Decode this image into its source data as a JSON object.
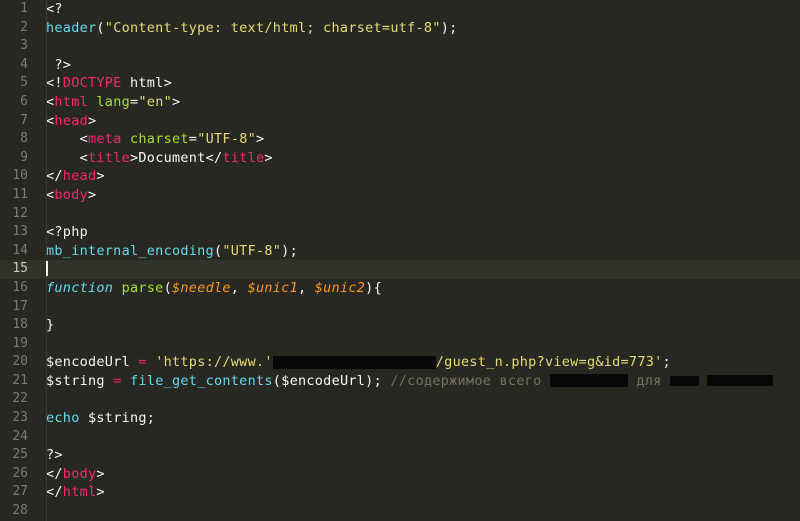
{
  "editor": {
    "theme_name": "monokai-dark",
    "background": "#272822",
    "gutter_color": "#7a7d72",
    "active_line_number": 15,
    "total_visible_lines": 28,
    "colors": {
      "tag": "#f92672",
      "attribute": "#a6e22e",
      "string": "#e6db74",
      "function": "#66d9ef",
      "keyword": "#66d9ef",
      "parameter": "#fd971f",
      "operator": "#f92672",
      "comment": "#75715e",
      "text": "#f8f8f2",
      "redaction": "#070707"
    },
    "language": "php"
  },
  "lines": [
    {
      "n": "1",
      "tokens": [
        {
          "t": "punc",
          "v": "<?"
        }
      ]
    },
    {
      "n": "2",
      "tokens": [
        {
          "t": "func",
          "v": "header"
        },
        {
          "t": "punc",
          "v": "("
        },
        {
          "t": "str",
          "v": "\"Content-type: text/html; charset=utf-8\""
        },
        {
          "t": "punc",
          "v": ");"
        }
      ]
    },
    {
      "n": "3",
      "tokens": []
    },
    {
      "n": "4",
      "tokens": [
        {
          "t": "punc",
          "v": " ?>"
        }
      ]
    },
    {
      "n": "5",
      "tokens": [
        {
          "t": "punc",
          "v": "<!"
        },
        {
          "t": "tag",
          "v": "DOCTYPE"
        },
        {
          "t": "plain",
          "v": " html>"
        }
      ]
    },
    {
      "n": "6",
      "tokens": [
        {
          "t": "punc",
          "v": "<"
        },
        {
          "t": "tag",
          "v": "html"
        },
        {
          "t": "plain",
          "v": " "
        },
        {
          "t": "attr",
          "v": "lang"
        },
        {
          "t": "plain",
          "v": "="
        },
        {
          "t": "str",
          "v": "\"en\""
        },
        {
          "t": "punc",
          "v": ">"
        }
      ]
    },
    {
      "n": "7",
      "tokens": [
        {
          "t": "punc",
          "v": "<"
        },
        {
          "t": "tag",
          "v": "head"
        },
        {
          "t": "punc",
          "v": ">"
        }
      ]
    },
    {
      "n": "8",
      "tokens": [
        {
          "t": "plain",
          "v": "    "
        },
        {
          "t": "punc",
          "v": "<"
        },
        {
          "t": "tag",
          "v": "meta"
        },
        {
          "t": "plain",
          "v": " "
        },
        {
          "t": "attr",
          "v": "charset"
        },
        {
          "t": "plain",
          "v": "="
        },
        {
          "t": "str",
          "v": "\"UTF-8\""
        },
        {
          "t": "punc",
          "v": ">"
        }
      ]
    },
    {
      "n": "9",
      "tokens": [
        {
          "t": "plain",
          "v": "    "
        },
        {
          "t": "punc",
          "v": "<"
        },
        {
          "t": "tag",
          "v": "title"
        },
        {
          "t": "punc",
          "v": ">"
        },
        {
          "t": "plain",
          "v": "Document"
        },
        {
          "t": "punc",
          "v": "</"
        },
        {
          "t": "tag",
          "v": "title"
        },
        {
          "t": "punc",
          "v": ">"
        }
      ]
    },
    {
      "n": "10",
      "tokens": [
        {
          "t": "punc",
          "v": "</"
        },
        {
          "t": "tag",
          "v": "head"
        },
        {
          "t": "punc",
          "v": ">"
        }
      ]
    },
    {
      "n": "11",
      "tokens": [
        {
          "t": "punc",
          "v": "<"
        },
        {
          "t": "tag",
          "v": "body"
        },
        {
          "t": "punc",
          "v": ">"
        }
      ]
    },
    {
      "n": "12",
      "tokens": []
    },
    {
      "n": "13",
      "tokens": [
        {
          "t": "punc",
          "v": "<?php"
        }
      ]
    },
    {
      "n": "14",
      "tokens": [
        {
          "t": "func",
          "v": "mb_internal_encoding"
        },
        {
          "t": "punc",
          "v": "("
        },
        {
          "t": "str",
          "v": "\"UTF-8\""
        },
        {
          "t": "punc",
          "v": ");"
        }
      ]
    },
    {
      "n": "15",
      "tokens": [
        {
          "t": "cursor",
          "v": ""
        }
      ],
      "active": true
    },
    {
      "n": "16",
      "tokens": [
        {
          "t": "kw",
          "v": "function"
        },
        {
          "t": "plain",
          "v": " "
        },
        {
          "t": "fname",
          "v": "parse"
        },
        {
          "t": "punc",
          "v": "("
        },
        {
          "t": "param",
          "v": "$needle"
        },
        {
          "t": "punc",
          "v": ", "
        },
        {
          "t": "param",
          "v": "$unic1"
        },
        {
          "t": "punc",
          "v": ", "
        },
        {
          "t": "param",
          "v": "$unic2"
        },
        {
          "t": "punc",
          "v": "){"
        }
      ]
    },
    {
      "n": "17",
      "tokens": []
    },
    {
      "n": "18",
      "tokens": [
        {
          "t": "punc",
          "v": "}"
        }
      ]
    },
    {
      "n": "19",
      "tokens": []
    },
    {
      "n": "20",
      "tokens": [
        {
          "t": "var",
          "v": "$encodeUrl"
        },
        {
          "t": "plain",
          "v": " "
        },
        {
          "t": "op",
          "v": "="
        },
        {
          "t": "plain",
          "v": " "
        },
        {
          "t": "str",
          "v": "'https://www.'"
        },
        {
          "t": "redact",
          "v": "r1"
        },
        {
          "t": "str",
          "v": "/guest_n.php?view=g&id=773'"
        },
        {
          "t": "punc",
          "v": ";"
        }
      ]
    },
    {
      "n": "21",
      "tokens": [
        {
          "t": "var",
          "v": "$string"
        },
        {
          "t": "plain",
          "v": " "
        },
        {
          "t": "op",
          "v": "="
        },
        {
          "t": "plain",
          "v": " "
        },
        {
          "t": "func",
          "v": "file_get_contents"
        },
        {
          "t": "punc",
          "v": "("
        },
        {
          "t": "var",
          "v": "$encodeUrl"
        },
        {
          "t": "punc",
          "v": ");"
        },
        {
          "t": "plain",
          "v": " "
        },
        {
          "t": "comment",
          "v": "//содержимое всего "
        },
        {
          "t": "redact",
          "v": "r2"
        },
        {
          "t": "comment",
          "v": " для "
        },
        {
          "t": "redact",
          "v": "r3"
        },
        {
          "t": "comment",
          "v": " "
        },
        {
          "t": "redact",
          "v": "r4"
        }
      ]
    },
    {
      "n": "22",
      "tokens": []
    },
    {
      "n": "23",
      "tokens": [
        {
          "t": "kw2",
          "v": "echo"
        },
        {
          "t": "plain",
          "v": " "
        },
        {
          "t": "var",
          "v": "$string"
        },
        {
          "t": "punc",
          "v": ";"
        }
      ]
    },
    {
      "n": "24",
      "tokens": []
    },
    {
      "n": "25",
      "tokens": [
        {
          "t": "punc",
          "v": "?>"
        }
      ]
    },
    {
      "n": "26",
      "tokens": [
        {
          "t": "punc",
          "v": "</"
        },
        {
          "t": "tag",
          "v": "body"
        },
        {
          "t": "punc",
          "v": ">"
        }
      ]
    },
    {
      "n": "27",
      "tokens": [
        {
          "t": "punc",
          "v": "</"
        },
        {
          "t": "tag",
          "v": "html"
        },
        {
          "t": "punc",
          "v": ">"
        }
      ]
    },
    {
      "n": "28",
      "tokens": []
    }
  ]
}
